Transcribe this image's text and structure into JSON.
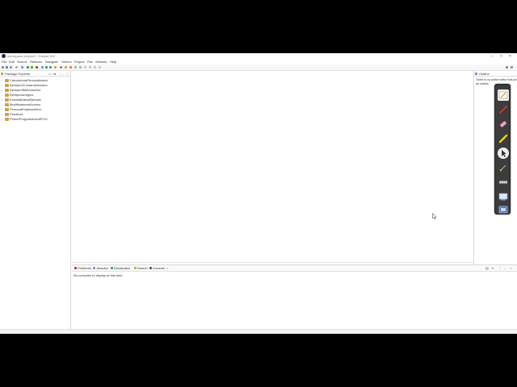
{
  "window": {
    "title": "workspace-eclipse3 - Eclipse IDE"
  },
  "menu": [
    "File",
    "Edit",
    "Source",
    "Refactor",
    "Navigate",
    "Search",
    "Project",
    "Run",
    "Window",
    "Help"
  ],
  "package_explorer": {
    "tab_label": "Package Explorer",
    "projects": [
      "CalculadoraPersonalizada",
      "Ejemplo2Comando/basico",
      "Ejemplo3MetodosSet",
      "EjemploArreglos",
      "EntradaDatosEjemplo",
      "ModificadoresAcceso",
      "PersonaEmpleadoEst",
      "Practica1",
      "PrimerProgramaJavaPOO"
    ]
  },
  "outline": {
    "tab_label": "Outline",
    "message": "There is no active editor that provides an outline."
  },
  "bottom_panel": {
    "tabs": [
      "Problems",
      "Javadoc",
      "Declaration",
      "Search",
      "Console"
    ],
    "message": "No consoles to display at this time."
  },
  "colors": {
    "folder": "#c9a24a",
    "toolbar_bg": "#f7f7f7",
    "annotation_bar": "#3c3c3c"
  },
  "annotation_tools": [
    "pen-icon",
    "red-marker-icon",
    "eraser-icon",
    "highlighter-icon",
    "pointer-icon",
    "brush-icon",
    "line-icon",
    "whiteboard-icon",
    "screen-icon"
  ]
}
